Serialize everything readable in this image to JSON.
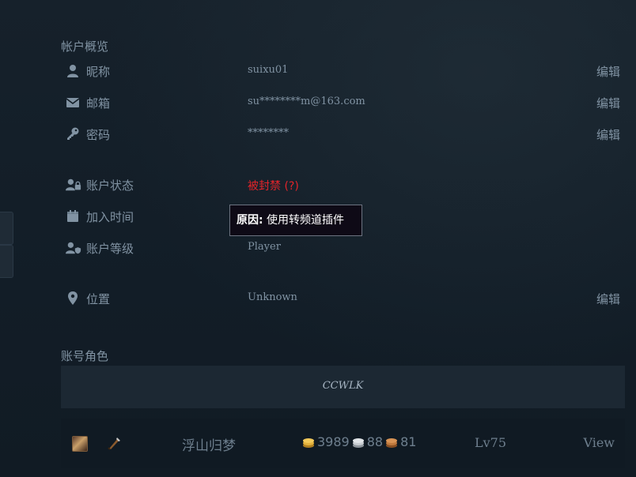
{
  "overview": {
    "title": "帐户概览",
    "rows": [
      {
        "icon": "user-icon",
        "label": "昵称",
        "value": "suixu01",
        "edit": "编辑"
      },
      {
        "icon": "envelope-icon",
        "label": "邮箱",
        "value": "su********m@163.com",
        "edit": "编辑"
      },
      {
        "icon": "key-icon",
        "label": "密码",
        "value": "********",
        "edit": "编辑"
      }
    ]
  },
  "status": {
    "label": "账户状态",
    "value": "被封禁 (?)",
    "value_color": "#e2242a",
    "icon": "user-lock-icon"
  },
  "join": {
    "label": "加入时间",
    "icon": "calendar-icon"
  },
  "level": {
    "label": "账户等级",
    "value": "Player",
    "icon": "user-shield-icon"
  },
  "location": {
    "label": "位置",
    "value": "Unknown",
    "edit": "编辑",
    "icon": "map-pin-icon"
  },
  "tooltip": {
    "label": "原因:",
    "text": " 使用转频道插件"
  },
  "roles": {
    "title": "账号角色",
    "server": "CCWLK",
    "characters": [
      {
        "name": "浮山归梦",
        "gold": "3989",
        "silver": "88",
        "copper": "81",
        "level": "Lv75",
        "action": "View"
      }
    ]
  },
  "colors": {
    "gold": "#e3b23c",
    "silver": "#c8cdd2",
    "copper": "#c07a3e",
    "text": "#8193a3",
    "danger": "#e2242a"
  }
}
